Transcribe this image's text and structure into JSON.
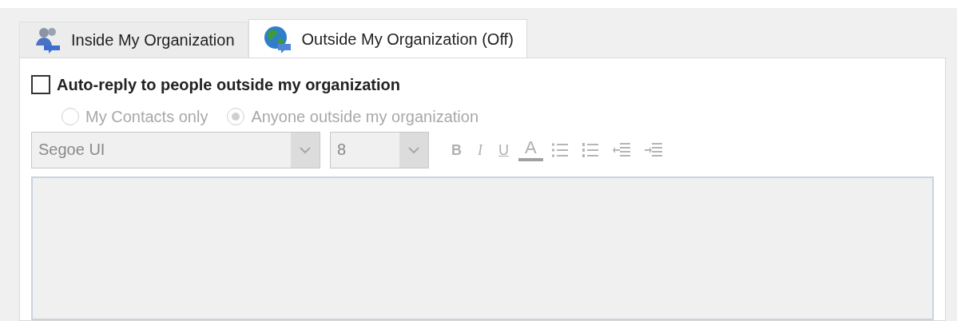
{
  "tabs": [
    {
      "label": "Inside My Organization",
      "selected": false,
      "kind": "people"
    },
    {
      "label": "Outside My Organization (Off)",
      "selected": true,
      "kind": "globe"
    }
  ],
  "auto_reply": {
    "label": "Auto-reply to people outside my organization",
    "checked": false
  },
  "audience": {
    "disabled": true,
    "options": [
      {
        "label": "My Contacts only",
        "selected": false
      },
      {
        "label": "Anyone outside my organization",
        "selected": true
      }
    ]
  },
  "font": {
    "value": "Segoe UI",
    "disabled": true
  },
  "size": {
    "value": "8",
    "disabled": true
  },
  "format_buttons": [
    {
      "kind": "bold",
      "label": "B"
    },
    {
      "kind": "italic",
      "label": "I"
    },
    {
      "kind": "underline",
      "label": "U"
    },
    {
      "kind": "color",
      "label": "A"
    },
    {
      "kind": "bullets"
    },
    {
      "kind": "numbering"
    },
    {
      "kind": "outdent"
    },
    {
      "kind": "indent"
    }
  ],
  "message": {
    "disabled": true
  }
}
